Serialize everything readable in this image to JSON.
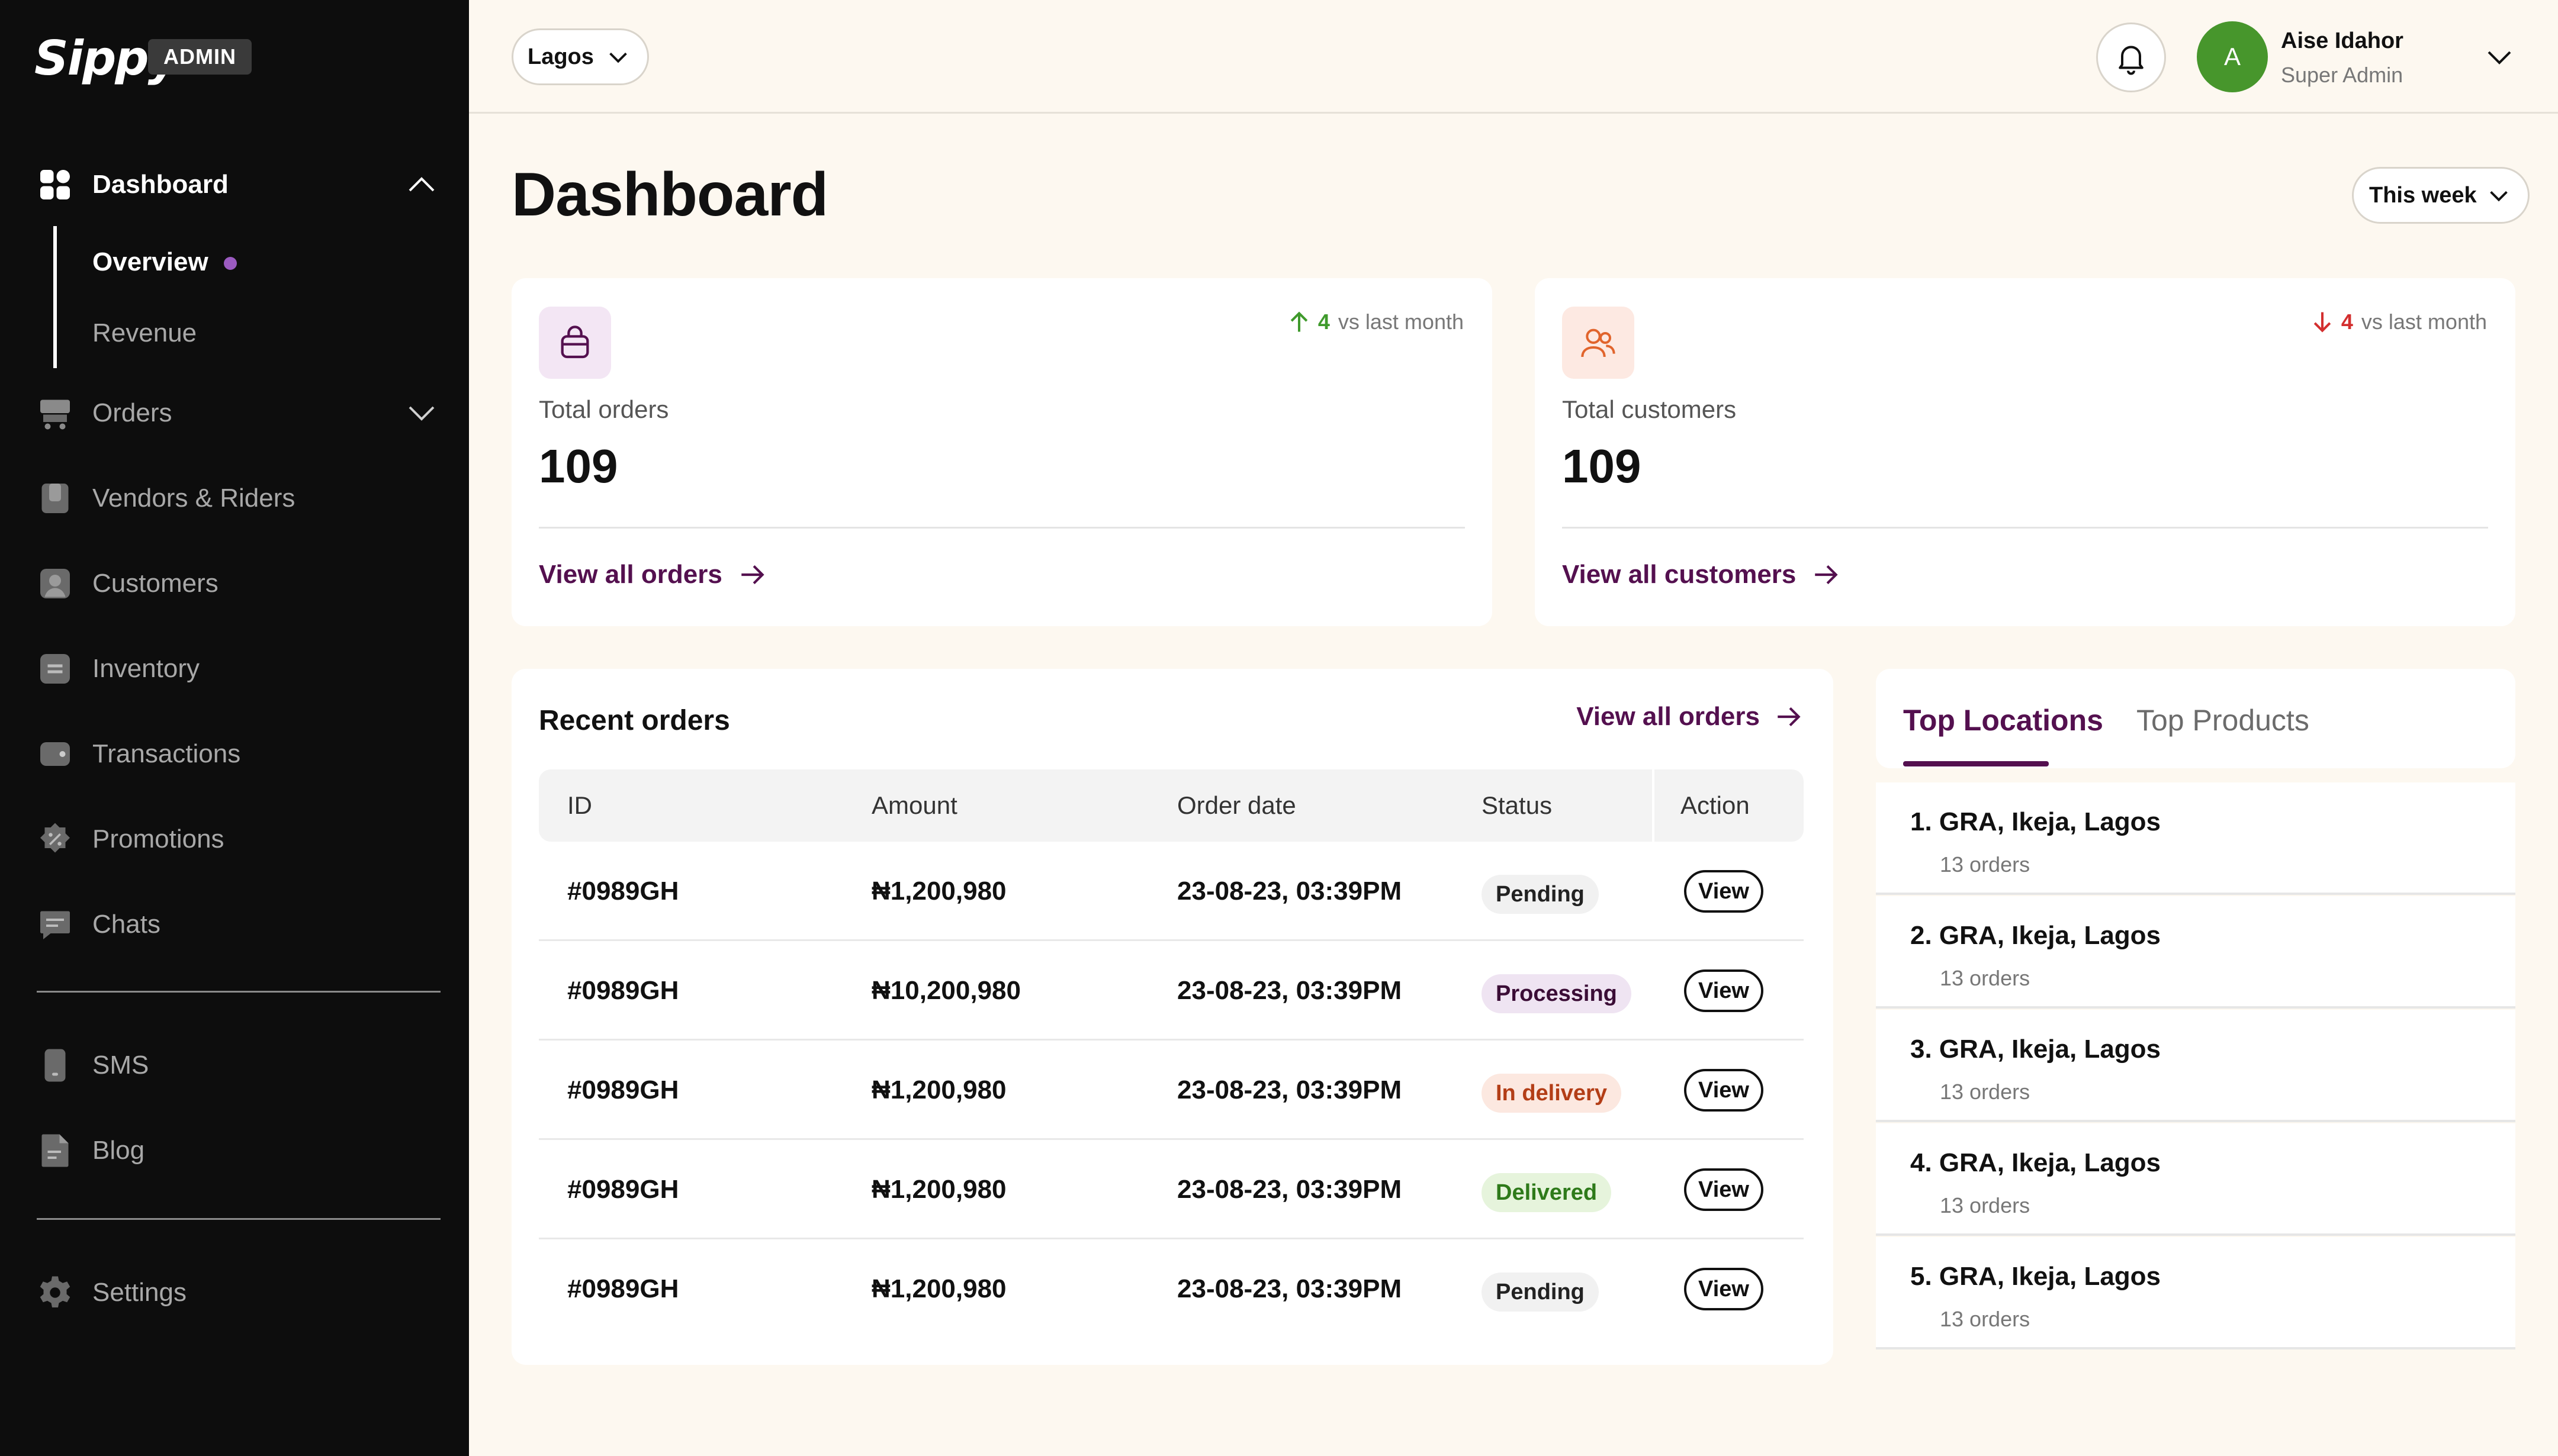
{
  "sidebar": {
    "logo": "Sippy",
    "badge": "ADMIN",
    "nav": {
      "dashboard": "Dashboard",
      "overview": "Overview",
      "revenue": "Revenue",
      "orders": "Orders",
      "vendors": "Vendors & Riders",
      "customers": "Customers",
      "inventory": "Inventory",
      "transactions": "Transactions",
      "promotions": "Promotions",
      "chats": "Chats",
      "sms": "SMS",
      "blog": "Blog",
      "settings": "Settings"
    }
  },
  "topbar": {
    "city": "Lagos",
    "avatar_initial": "A",
    "user_name": "Aise Idahor",
    "user_role": "Super Admin"
  },
  "page": {
    "title": "Dashboard",
    "period": "This week"
  },
  "stats": [
    {
      "label": "Total orders",
      "value": "109",
      "trend": "4",
      "trend_text": "vs last month",
      "trend_dir": "up",
      "link": "View all orders"
    },
    {
      "label": "Total customers",
      "value": "109",
      "trend": "4",
      "trend_text": "vs last month",
      "trend_dir": "down",
      "link": "View all customers"
    }
  ],
  "recent_orders": {
    "title": "Recent orders",
    "link": "View all orders",
    "columns": [
      "ID",
      "Amount",
      "Order date",
      "Status",
      "Action"
    ],
    "rows": [
      {
        "id": "#0989GH",
        "amount": "₦1,200,980",
        "date": "23-08-23, 03:39PM",
        "status": "Pending",
        "action": "View"
      },
      {
        "id": "#0989GH",
        "amount": "₦10,200,980",
        "date": "23-08-23, 03:39PM",
        "status": "Processing",
        "action": "View"
      },
      {
        "id": "#0989GH",
        "amount": "₦1,200,980",
        "date": "23-08-23, 03:39PM",
        "status": "In delivery",
        "action": "View"
      },
      {
        "id": "#0989GH",
        "amount": "₦1,200,980",
        "date": "23-08-23, 03:39PM",
        "status": "Delivered",
        "action": "View"
      },
      {
        "id": "#0989GH",
        "amount": "₦1,200,980",
        "date": "23-08-23, 03:39PM",
        "status": "Pending",
        "action": "View"
      }
    ]
  },
  "top_panel": {
    "tabs": [
      "Top Locations",
      "Top Products"
    ],
    "locations": [
      {
        "name": "1. GRA, Ikeja, Lagos",
        "count": "13 orders"
      },
      {
        "name": "2. GRA, Ikeja, Lagos",
        "count": "13 orders"
      },
      {
        "name": "3. GRA, Ikeja, Lagos",
        "count": "13 orders"
      },
      {
        "name": "4. GRA, Ikeja, Lagos",
        "count": "13 orders"
      },
      {
        "name": "5. GRA, Ikeja, Lagos",
        "count": "13 orders"
      }
    ]
  },
  "colors": {
    "brand_purple": "#54104f",
    "accent_dot": "#9b5bc0",
    "trend_up": "#3f9a2c",
    "trend_down": "#d32f2f",
    "avatar": "#47962c",
    "badge_pending_bg": "#f1f1f1",
    "badge_processing_bg": "#efe4f2",
    "badge_delivery_bg": "#fce8e0",
    "badge_delivery_text": "#b33e17",
    "badge_delivered_bg": "#e6f4dc",
    "badge_delivered_text": "#2e7a1a"
  },
  "icons": {
    "dashboard": "grid-icon",
    "orders": "cart-icon",
    "vendors": "store-icon",
    "customers": "user-icon",
    "inventory": "box-icon",
    "transactions": "wallet-icon",
    "promotions": "percent-badge-icon",
    "chats": "chat-icon",
    "sms": "phone-icon",
    "blog": "document-icon",
    "settings": "gear-icon",
    "stat_orders": "bag-icon",
    "stat_customers": "users-icon"
  }
}
